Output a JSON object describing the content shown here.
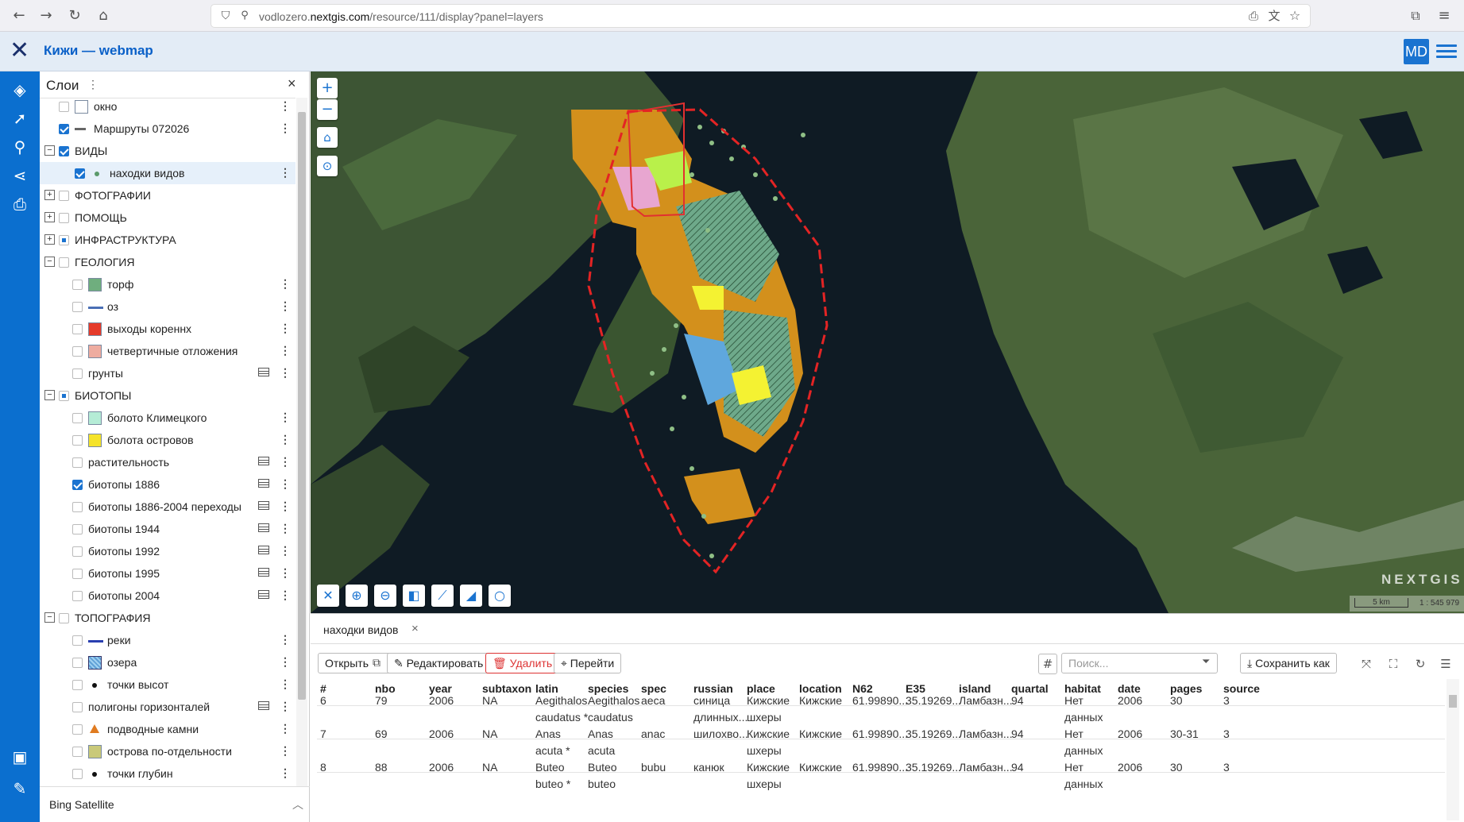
{
  "browser": {
    "url_prefix": "vodlozero.",
    "url_domain": "nextgis.com",
    "url_path": "/resource/111/display?panel=layers"
  },
  "app": {
    "title": "Кижи — webmap",
    "user_initials": "MD"
  },
  "layers_panel": {
    "title": "Слои",
    "basemap": "Bing Satellite",
    "rows": [
      {
        "label": "окно",
        "indent": 2,
        "checked": "off",
        "symbol": "box-white",
        "table": false
      },
      {
        "label": "Маршруты 072026",
        "indent": 2,
        "checked": "on",
        "symbol": "line-gray",
        "table": false
      },
      {
        "label": "ВИДЫ",
        "indent": 1,
        "checked": "on",
        "expander": "−",
        "group": true
      },
      {
        "label": "находки видов",
        "indent": 3,
        "checked": "on",
        "symbol": "dot-green",
        "table": false,
        "selected": true
      },
      {
        "label": "ФОТОГРАФИИ",
        "indent": 1,
        "checked": "off",
        "expander": "+",
        "group": true
      },
      {
        "label": "ПОМОЩЬ",
        "indent": 1,
        "checked": "off",
        "expander": "+",
        "group": true
      },
      {
        "label": "ИНФРАСТРУКТУРА",
        "indent": 1,
        "checked": "part",
        "expander": "+",
        "group": true
      },
      {
        "label": "ГЕОЛОГИЯ",
        "indent": 1,
        "checked": "off",
        "expander": "−",
        "group": true
      },
      {
        "label": "торф",
        "indent": 3,
        "checked": "off",
        "symbol": "box-#6fae7e",
        "table": false
      },
      {
        "label": "оз",
        "indent": 3,
        "checked": "off",
        "symbol": "line-#4a6fb5",
        "table": false
      },
      {
        "label": "выходы кореннх",
        "indent": 3,
        "checked": "off",
        "symbol": "box-#e53a2a",
        "table": false
      },
      {
        "label": "четвертичные отложения",
        "indent": 3,
        "checked": "off",
        "symbol": "box-#eeaca0",
        "table": false
      },
      {
        "label": "грунты",
        "indent": 3,
        "checked": "off",
        "symbol": "none",
        "table": true
      },
      {
        "label": "БИОТОПЫ",
        "indent": 1,
        "checked": "part",
        "expander": "−",
        "group": true
      },
      {
        "label": "болото Климецкого",
        "indent": 3,
        "checked": "off",
        "symbol": "box-#b5ecd6",
        "table": false
      },
      {
        "label": "болота островов",
        "indent": 3,
        "checked": "off",
        "symbol": "box-#f5e32a",
        "table": false
      },
      {
        "label": "растительность",
        "indent": 3,
        "checked": "off",
        "symbol": "none",
        "table": true
      },
      {
        "label": "биотопы 1886",
        "indent": 3,
        "checked": "on",
        "symbol": "none",
        "table": true
      },
      {
        "label": "биотопы 1886-2004 переходы",
        "indent": 3,
        "checked": "off",
        "symbol": "none",
        "table": true
      },
      {
        "label": "биотопы 1944",
        "indent": 3,
        "checked": "off",
        "symbol": "none",
        "table": true
      },
      {
        "label": "биотопы 1992",
        "indent": 3,
        "checked": "off",
        "symbol": "none",
        "table": true
      },
      {
        "label": "биотопы 1995",
        "indent": 3,
        "checked": "off",
        "symbol": "none",
        "table": true
      },
      {
        "label": "биотопы 2004",
        "indent": 3,
        "checked": "off",
        "symbol": "none",
        "table": true
      },
      {
        "label": "ТОПОГРАФИЯ",
        "indent": 1,
        "checked": "off",
        "expander": "−",
        "group": true
      },
      {
        "label": "реки",
        "indent": 3,
        "checked": "off",
        "symbol": "line-#2a3fb0",
        "table": false
      },
      {
        "label": "озера",
        "indent": 3,
        "checked": "off",
        "symbol": "hatch-blue",
        "table": false
      },
      {
        "label": "точки высот",
        "indent": 3,
        "checked": "off",
        "symbol": "dot-black",
        "table": false
      },
      {
        "label": "полигоны горизонталей",
        "indent": 3,
        "checked": "off",
        "symbol": "none",
        "table": true
      },
      {
        "label": "подводные камни",
        "indent": 3,
        "checked": "off",
        "symbol": "tri-#e07b20",
        "table": false
      },
      {
        "label": "острова по-отдельности",
        "indent": 3,
        "checked": "off",
        "symbol": "box-#c9c979",
        "table": false
      },
      {
        "label": "точки глубин",
        "indent": 3,
        "checked": "off",
        "symbol": "dot-black",
        "table": false
      }
    ]
  },
  "map": {
    "watermark": "NEXTGIS",
    "scale_bar": "5 km",
    "scale_ratio": "1 : 545 979"
  },
  "table_panel": {
    "tab_label": "находки видов",
    "buttons": {
      "open": "Открыть",
      "edit": "Редактировать",
      "delete": "Удалить",
      "goto": "Перейти",
      "save_as": "Сохранить как"
    },
    "search_placeholder": "Поиск...",
    "columns": [
      "#",
      "nbo",
      "year",
      "subtaxon",
      "latin",
      "species",
      "spec",
      "russian",
      "place",
      "location",
      "N62",
      "E35",
      "island",
      "quartal",
      "habitat",
      "date",
      "pages",
      "source"
    ],
    "rows": [
      [
        "6",
        "79",
        "2006",
        "NA",
        "Aegithalos caudatus *",
        "Aegithalos caudatus",
        "aeca",
        "синица длинных...",
        "Кижские шхеры",
        "Кижские",
        "61.99890...",
        "35.19269...",
        "Ламбазн...",
        "94",
        "Нет данных",
        "2006",
        "30",
        "3"
      ],
      [
        "7",
        "69",
        "2006",
        "NA",
        "Anas acuta *",
        "Anas acuta",
        "anac",
        "шилохво...",
        "Кижские шхеры",
        "Кижские",
        "61.99890...",
        "35.19269...",
        "Ламбазн...",
        "94",
        "Нет данных",
        "2006",
        "30-31",
        "3"
      ],
      [
        "8",
        "88",
        "2006",
        "NA",
        "Buteo buteo *",
        "Buteo buteo",
        "bubu",
        "канюк",
        "Кижские шхеры",
        "Кижские",
        "61.99890...",
        "35.19269...",
        "Ламбазн...",
        "94",
        "Нет данных",
        "2006",
        "30",
        "3"
      ]
    ]
  }
}
